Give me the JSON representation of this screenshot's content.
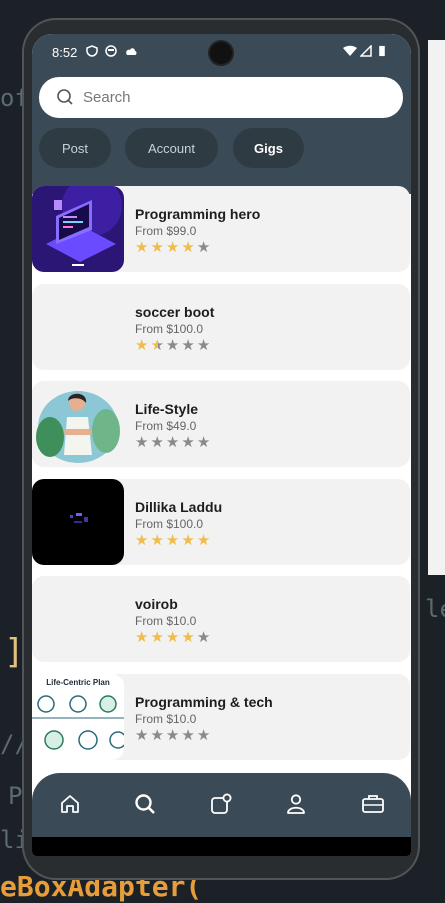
{
  "status": {
    "time": "8:52"
  },
  "search": {
    "placeholder": "Search"
  },
  "tabs": [
    {
      "label": "Post",
      "active": false
    },
    {
      "label": "Account",
      "active": false
    },
    {
      "label": "Gigs",
      "active": true
    }
  ],
  "gigs": [
    {
      "title": "Programming hero",
      "price": "From $99.0",
      "rating": 4,
      "thumb": "laptop-illustration"
    },
    {
      "title": "soccer boot",
      "price": "From $100.0",
      "rating": 1.5,
      "thumb": "blank"
    },
    {
      "title": "Life-Style",
      "price": "From $49.0",
      "rating": 0,
      "thumb": "woman-leaves-illustration"
    },
    {
      "title": "Dillika Laddu",
      "price": "From $100.0",
      "rating": 5,
      "thumb": "dark-room-photo"
    },
    {
      "title": "voirob",
      "price": "From $10.0",
      "rating": 4,
      "thumb": "blank"
    },
    {
      "title": "Programming & tech",
      "price": "From $10.0",
      "rating": 0,
      "thumb": "life-centric-plan-diagram",
      "thumb_caption": "Life-Centric Plan"
    }
  ],
  "nav": [
    "home-icon",
    "search-icon",
    "post-icon",
    "profile-icon",
    "briefcase-icon"
  ],
  "colors": {
    "header": "#3a4b57",
    "chip": "#2f3b43",
    "card": "#f2f2f2",
    "star_on": "#f0bc4a",
    "star_off": "#8a8a8a"
  }
}
